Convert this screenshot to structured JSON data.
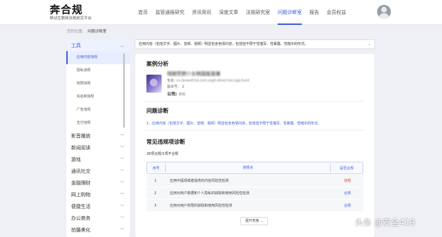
{
  "brand": {
    "name": "奔合规",
    "subtitle": "移动互联网法规研究平台"
  },
  "nav": [
    "首页",
    "监管通报研究",
    "资讯简讯",
    "深度文章",
    "法规研究室",
    "问题诊断室",
    "报告",
    "会员权益"
  ],
  "nav_active_index": 5,
  "breadcrumb": {
    "prefix": "您的位置:",
    "current": "问题诊断室"
  },
  "sidebar": {
    "open_group": "工具",
    "sub_items": [
      "应用内容违规",
      "隐私违规",
      "权限违规",
      "实名制违规",
      "广告违规",
      "支付违规"
    ],
    "groups": [
      "影音播放",
      "新闻阅读",
      "游戏",
      "通讯社交",
      "金融理财",
      "网上购物",
      "便捷生活",
      "办公商务",
      "拍摄美化"
    ]
  },
  "select_value": "应用内容（包括文字、图片、音频、视频）明显包含色情内容，包括但不限于性描写、性暴露、性暗示的形式。",
  "case": {
    "heading": "案例分析",
    "app_name": "晴朗荒野少女韩国版直播",
    "package_label": "包名:",
    "package_value": "cn.ferwolf.hd.com.orgtl.direct.bd.ngq.fund",
    "version_label": "版本号：",
    "version_value": "2",
    "company_label": "公司:",
    "company_value": "未知"
  },
  "diagnosis": {
    "heading": "问题诊断",
    "text": "1、应用内容（包括文字、图片、音频、视频）明显包含色情内容，包括但不限于性描写、性暴露、性暗示的形式。"
  },
  "violations": {
    "heading": "常见违规项诊断",
    "count_text": "26项合规/1项不合规",
    "columns": [
      "序号",
      "违规点",
      "是否合规"
    ],
    "rows": [
      {
        "no": "1",
        "point": "应用中提现或者提供的内容风险性检测",
        "status": "违规",
        "status_color": "#d83a3a"
      },
      {
        "no": "2",
        "point": "应用对用户数据和个人隐私的获取和使用风险性检测",
        "status": "合规",
        "status_color": "#3a5bd9"
      },
      {
        "no": "3",
        "point": "应用对用户权限的获取和使用风险性检测",
        "status": "合规",
        "status_color": "#3a5bd9"
      }
    ],
    "expand_label": "展开表格 ⌄"
  },
  "watermark": "头条 @安全419",
  "colors": {
    "accent": "#3a5bd9",
    "violation": "#d83a3a"
  }
}
